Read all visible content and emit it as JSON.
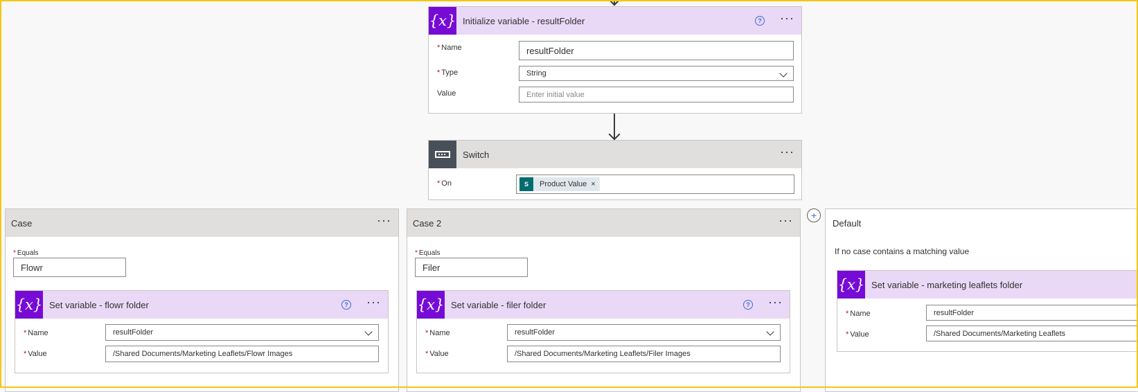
{
  "init_var": {
    "title": "Initialize variable - resultFolder",
    "name_label": "Name",
    "name_value": "resultFolder",
    "type_label": "Type",
    "type_value": "String",
    "value_label": "Value",
    "value_placeholder": "Enter initial value"
  },
  "switch": {
    "title": "Switch",
    "on_label": "On",
    "token_label": "Product Value",
    "token_icon": "sharepoint-icon",
    "token_close": "×"
  },
  "cases": [
    {
      "title": "Case",
      "equals_label": "Equals",
      "equals_value": "Flowr",
      "action": {
        "title": "Set variable - flowr folder",
        "name_label": "Name",
        "name_value": "resultFolder",
        "value_label": "Value",
        "value_value": "/Shared Documents/Marketing Leaflets/Flowr Images"
      }
    },
    {
      "title": "Case 2",
      "equals_label": "Equals",
      "equals_value": "Filer",
      "action": {
        "title": "Set variable - filer folder",
        "name_label": "Name",
        "name_value": "resultFolder",
        "value_label": "Value",
        "value_value": "/Shared Documents/Marketing Leaflets/Filer Images"
      }
    }
  ],
  "default_case": {
    "title": "Default",
    "description": "If no case contains a matching value",
    "action": {
      "title": "Set variable - marketing leaflets folder",
      "name_label": "Name",
      "name_value": "resultFolder",
      "value_label": "Value",
      "value_value": "/Shared Documents/Marketing Leaflets"
    }
  },
  "glyphs": {
    "variable_icon": "{x}",
    "help_icon": "?",
    "more_icon": "···",
    "required": "*",
    "add_case": "+"
  },
  "colors": {
    "variable_accent": "#770bd6",
    "variable_header": "#ead8f7",
    "switch_accent": "#484f58",
    "case_header": "#e1dfdd",
    "frame_border": "#f2c811",
    "sharepoint": "#036c70",
    "required": "#c50f1f"
  }
}
